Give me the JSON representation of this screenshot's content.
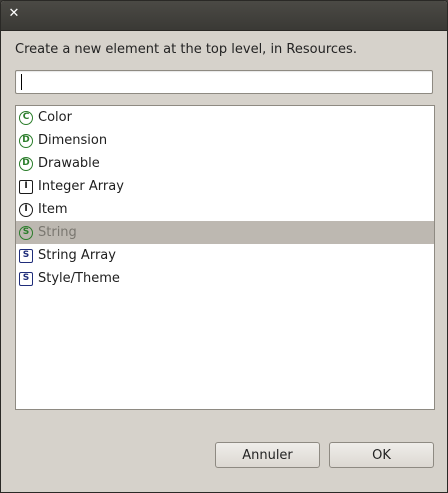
{
  "window": {
    "close_glyph": "✕"
  },
  "prompt": "Create a new element at the top level, in Resources.",
  "search": {
    "value": "",
    "placeholder": ""
  },
  "items": [
    {
      "letter": "C",
      "label": "Color",
      "icon": "color-icon",
      "shape": "circle",
      "color": "#2a7d2a"
    },
    {
      "letter": "D",
      "label": "Dimension",
      "icon": "dimension-icon",
      "shape": "circle",
      "color": "#2a7d2a"
    },
    {
      "letter": "D",
      "label": "Drawable",
      "icon": "drawable-icon",
      "shape": "circle",
      "color": "#2a7d2a"
    },
    {
      "letter": "I",
      "label": "Integer Array",
      "icon": "integer-array-icon",
      "shape": "square",
      "color": "#1a1a1a"
    },
    {
      "letter": "I",
      "label": "Item",
      "icon": "item-icon",
      "shape": "circle",
      "color": "#1a1a1a"
    },
    {
      "letter": "S",
      "label": "String",
      "icon": "string-icon",
      "shape": "circle",
      "color": "#2a7d2a",
      "selected": true
    },
    {
      "letter": "S",
      "label": "String Array",
      "icon": "string-array-icon",
      "shape": "square",
      "color": "#1f2d7a"
    },
    {
      "letter": "S",
      "label": "Style/Theme",
      "icon": "style-theme-icon",
      "shape": "square",
      "color": "#1f2d7a"
    }
  ],
  "buttons": {
    "cancel": "Annuler",
    "ok": "OK"
  }
}
